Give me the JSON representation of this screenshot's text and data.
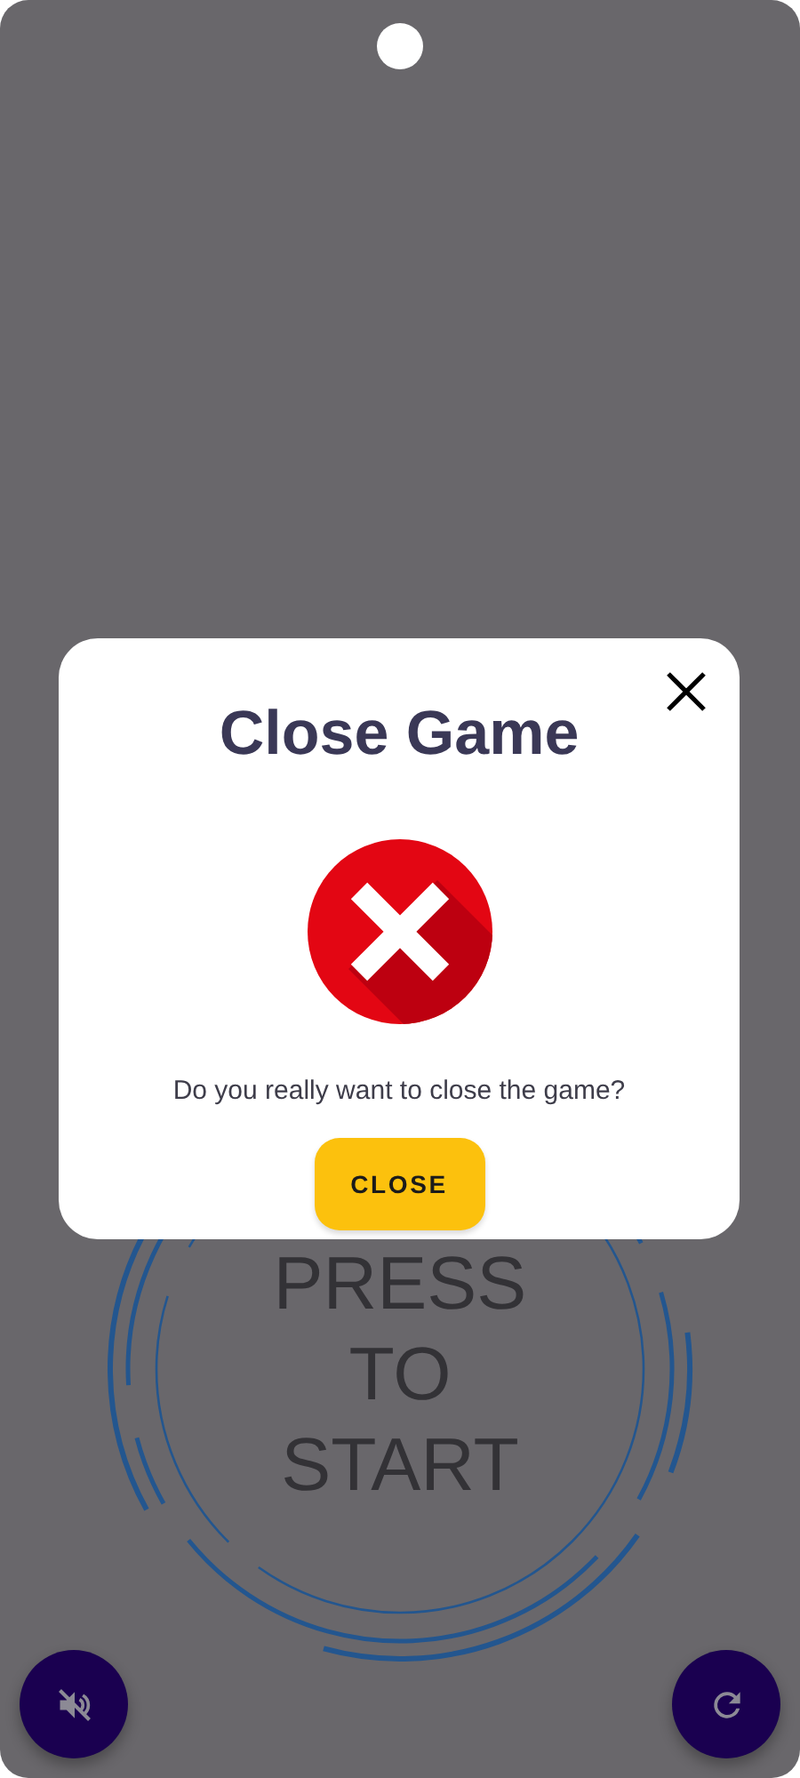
{
  "game": {
    "start_prompt": "PRESS TO START"
  },
  "dialog": {
    "title": "Close Game",
    "message": "Do you really want to close the game?",
    "button": "CLOSE"
  }
}
